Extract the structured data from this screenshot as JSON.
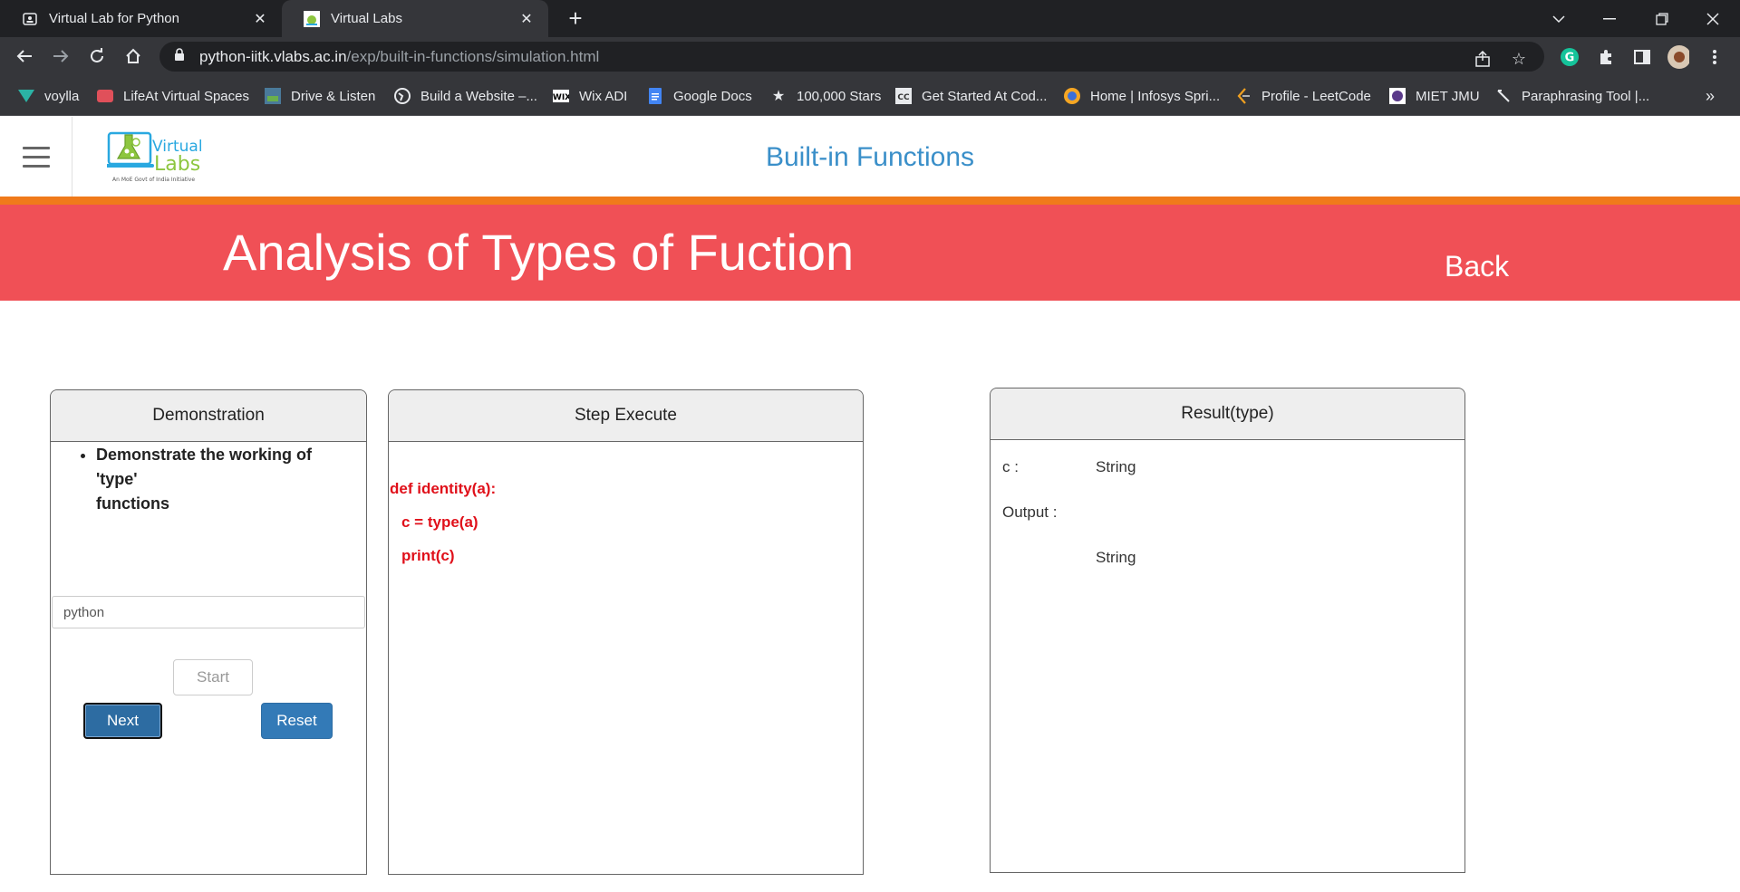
{
  "browser": {
    "tabs": [
      {
        "title": "Virtual Lab for Python",
        "active": false
      },
      {
        "title": "Virtual Labs",
        "active": true
      }
    ],
    "url_host": "python-iitk.vlabs.ac.in",
    "url_path": "/exp/built-in-functions/simulation.html",
    "bookmarks": [
      {
        "label": "voylla",
        "icon": "voylla-icon"
      },
      {
        "label": "LifeAt Virtual Spaces",
        "icon": "lifeat-icon"
      },
      {
        "label": "Drive & Listen",
        "icon": "drive-listen-icon"
      },
      {
        "label": "Build a Website –...",
        "icon": "globe-icon"
      },
      {
        "label": "Wix ADI",
        "icon": "wix-icon"
      },
      {
        "label": "Google Docs",
        "icon": "google-docs-icon"
      },
      {
        "label": "100,000 Stars",
        "icon": "star-icon"
      },
      {
        "label": "Get Started At Cod...",
        "icon": "codecademy-icon"
      },
      {
        "label": "Home | Infosys Spri...",
        "icon": "infosys-icon"
      },
      {
        "label": "Profile - LeetCode",
        "icon": "leetcode-icon"
      },
      {
        "label": "MIET JMU",
        "icon": "miet-icon"
      },
      {
        "label": "Paraphrasing Tool |...",
        "icon": "quill-icon"
      }
    ],
    "colors": {
      "chrome_dark": "#202124",
      "chrome_mid": "#35363a"
    }
  },
  "site": {
    "logo_text_1": "Virtual",
    "logo_text_2": "Labs",
    "logo_tagline": "An MoE Govt of India Initiative",
    "heading": "Built-in Functions",
    "banner_title": "Analysis of Types of Fuction",
    "back_label": "Back",
    "colors": {
      "heading": "#3a8fc9",
      "orange_bar": "#f07a1a",
      "banner": "#f05056",
      "code": "#e0101a",
      "button_primary": "#337ab7"
    }
  },
  "demonstration": {
    "title": "Demonstration",
    "item_line1": "Demonstrate the working of",
    "item_line2": "'type'",
    "item_line3": "functions",
    "input_value": "python",
    "start_label": "Start",
    "next_label": "Next",
    "reset_label": "Reset"
  },
  "step_execute": {
    "title": "Step Execute",
    "code_lines": [
      "def identity(a):",
      "c = type(a)",
      "print(c)"
    ]
  },
  "result": {
    "title": "Result(type)",
    "c_label": "c :",
    "c_value": "String",
    "output_label": "Output :",
    "output_value": "String"
  }
}
